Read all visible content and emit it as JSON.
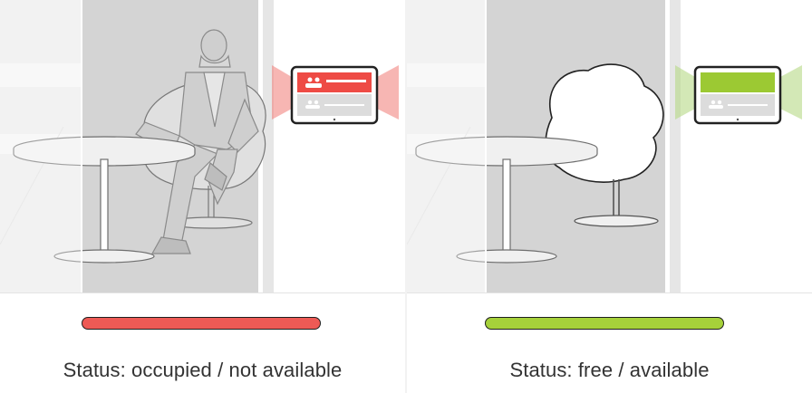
{
  "panels": [
    {
      "id": "occupied",
      "status_text": "Status: occupied / not available",
      "status_color": "#ee5a55",
      "device_header_color": "#ee4b45",
      "device_glow_color": "#f07a74",
      "person_present": true
    },
    {
      "id": "free",
      "status_text": "Status: free / available",
      "status_color": "#a6d13a",
      "device_header_color": "#9cc933",
      "device_glow_color": "#b6d985",
      "person_present": false
    }
  ],
  "icons": {
    "device": "room-booking-display-icon",
    "group": "people-group-icon"
  }
}
